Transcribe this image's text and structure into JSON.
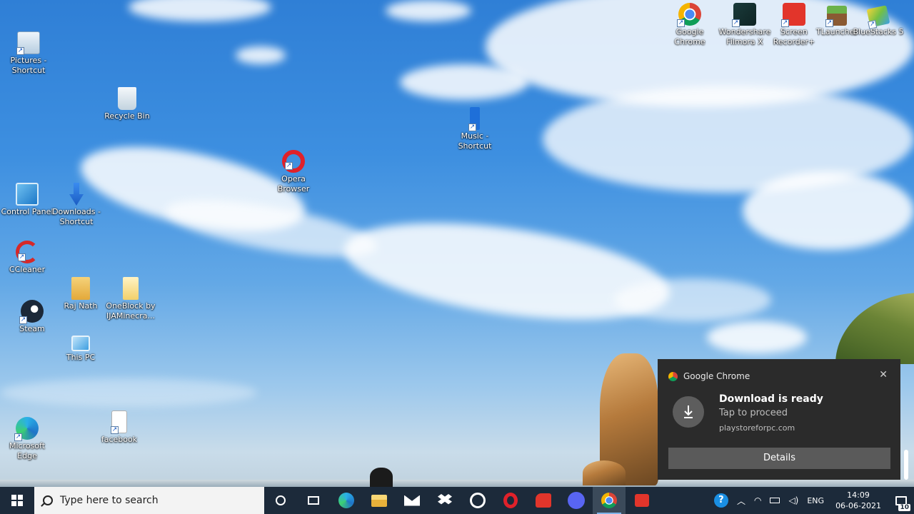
{
  "desktop": {
    "icons": [
      {
        "label": "Pictures - Shortcut",
        "icon": "pictures-icon"
      },
      {
        "label": "Recycle Bin",
        "icon": "recycle-bin-icon"
      },
      {
        "label": "Music - Shortcut",
        "icon": "music-icon"
      },
      {
        "label": "Opera Browser",
        "icon": "opera-icon"
      },
      {
        "label": "Control Panel",
        "icon": "control-panel-icon"
      },
      {
        "label": "Downloads - Shortcut",
        "icon": "downloads-icon"
      },
      {
        "label": "CCleaner",
        "icon": "ccleaner-icon"
      },
      {
        "label": "Raj Nath",
        "icon": "user-folder-icon"
      },
      {
        "label": "OneBlock by IJAMinecra...",
        "icon": "folder-icon"
      },
      {
        "label": "Steam",
        "icon": "steam-icon"
      },
      {
        "label": "This PC",
        "icon": "this-pc-icon"
      },
      {
        "label": "Microsoft Edge",
        "icon": "edge-icon"
      },
      {
        "label": "facebook",
        "icon": "file-icon"
      },
      {
        "label": "Google Chrome",
        "icon": "chrome-icon"
      },
      {
        "label": "Wondershare Filmora X",
        "icon": "filmora-icon"
      },
      {
        "label": "Screen Recorder+",
        "icon": "screen-recorder-icon"
      },
      {
        "label": "TLauncher",
        "icon": "tlauncher-icon"
      },
      {
        "label": "BlueStacks 5",
        "icon": "bluestacks-icon"
      }
    ]
  },
  "toast": {
    "app": "Google Chrome",
    "title": "Download is ready",
    "subtitle": "Tap to proceed",
    "source": "playstoreforpc.com",
    "button": "Details",
    "close": "✕"
  },
  "taskbar": {
    "search_placeholder": "Type here to search",
    "apps": [
      "cortana-icon",
      "task-view-icon",
      "edge-icon",
      "file-explorer-icon",
      "mail-icon",
      "dropbox-icon",
      "avast-icon",
      "opera-icon",
      "shutdown-app-icon",
      "discord-icon",
      "chrome-icon",
      "screen-recorder-icon"
    ],
    "active_app": "chrome-icon",
    "tray": {
      "language": "ENG",
      "time": "14:09",
      "date": "06-06-2021",
      "notifications": "10"
    }
  },
  "colors": {
    "taskbar": "#1c2a3a",
    "toast_bg": "#2b2b2b",
    "toast_button": "#5a5a5a"
  }
}
